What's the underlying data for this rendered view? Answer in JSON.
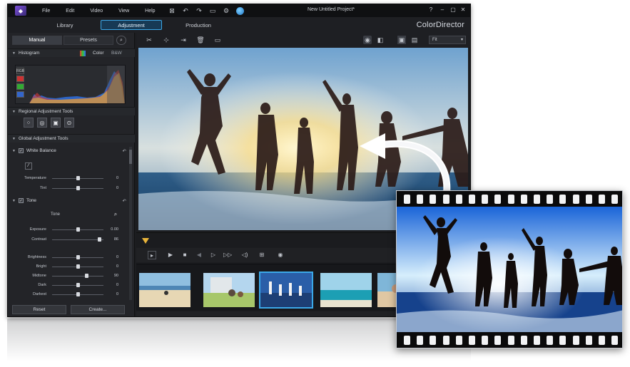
{
  "window": {
    "doc_title": "New Untitled Project*",
    "brand": "ColorDirector"
  },
  "menu": [
    "File",
    "Edit",
    "Video",
    "View",
    "Help"
  ],
  "modes": [
    {
      "label": "Library"
    },
    {
      "label": "Adjustment"
    },
    {
      "label": "Production"
    }
  ],
  "panel": {
    "tabs": [
      "Manual",
      "Presets"
    ],
    "histogram": {
      "title": "Histogram",
      "color_label": "Color",
      "bw_label": "B&W",
      "rgb_label": "RGB"
    },
    "regional_title": "Regional Adjustment Tools",
    "global_title": "Global Adjustment Tools",
    "white_balance": {
      "title": "White Balance",
      "sliders": [
        {
          "label": "Temperature",
          "value": "0",
          "level": 0.5
        },
        {
          "label": "Tint",
          "value": "0",
          "level": 0.5
        }
      ]
    },
    "tone": {
      "title": "Tone",
      "subtitle": "Tone",
      "sliders": [
        {
          "label": "Exposure",
          "value": "0.00",
          "level": 0.5
        },
        {
          "label": "Contrast",
          "value": "86",
          "level": 0.93
        }
      ],
      "sliders2": [
        {
          "label": "Brightness",
          "value": "0",
          "level": 0.5
        },
        {
          "label": "Bright",
          "value": "0",
          "level": 0.5
        },
        {
          "label": "Midtone",
          "value": "90",
          "level": 0.68
        },
        {
          "label": "Dark",
          "value": "0",
          "level": 0.5
        },
        {
          "label": "Darkest",
          "value": "0",
          "level": 0.5
        }
      ]
    },
    "reset_label": "Reset",
    "create_label": "Create..."
  },
  "viewer": {
    "fit_label": "Fit"
  },
  "colors": {
    "accent": "#3ba8e8",
    "panel_bg": "#232428",
    "window_bg": "#1c1d20",
    "playhead": "#e8b43a"
  }
}
